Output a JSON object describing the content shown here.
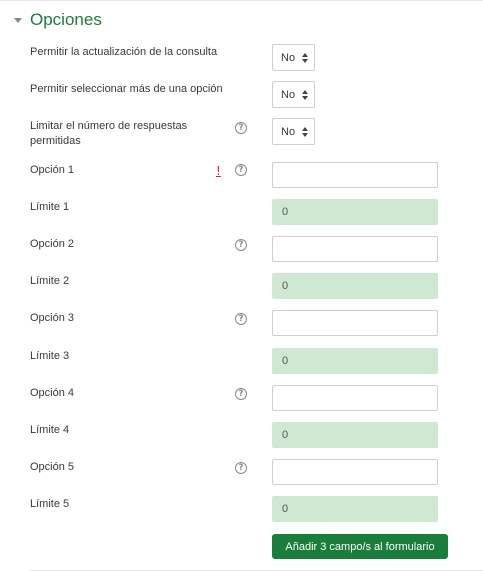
{
  "section": {
    "title": "Opciones"
  },
  "settings": [
    {
      "label": "Permitir la actualización de la consulta",
      "value": "No"
    },
    {
      "label": "Permitir seleccionar más de una opción",
      "value": "No"
    },
    {
      "label": "Limitar el número de respuestas permitidas",
      "value": "No"
    }
  ],
  "options": [
    {
      "label": "Opción 1",
      "value": "",
      "limit_label": "Límite 1",
      "limit_value": "0"
    },
    {
      "label": "Opción 2",
      "value": "",
      "limit_label": "Límite 2",
      "limit_value": "0"
    },
    {
      "label": "Opción 3",
      "value": "",
      "limit_label": "Límite 3",
      "limit_value": "0"
    },
    {
      "label": "Opción 4",
      "value": "",
      "limit_label": "Límite 4",
      "limit_value": "0"
    },
    {
      "label": "Opción 5",
      "value": "",
      "limit_label": "Límite 5",
      "limit_value": "0"
    }
  ],
  "icons": {
    "required": "!",
    "help": "?"
  },
  "add_button": {
    "label": "Añadir 3 campo/s al formulario"
  },
  "colors": {
    "accent": "#1a7d3a",
    "title": "#1f7a3f",
    "limit_bg": "#cfe8d1",
    "required": "#d62222"
  }
}
